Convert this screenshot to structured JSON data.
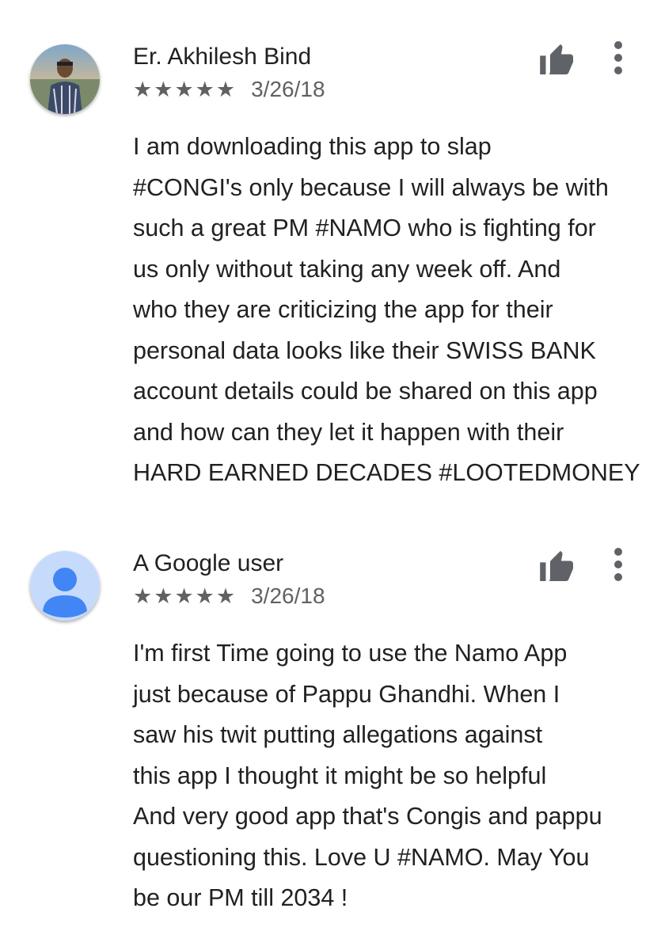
{
  "reviews": [
    {
      "author": "Er. Akhilesh Bind",
      "avatar": "user-photo",
      "stars": [
        "★",
        "★",
        "★",
        "★",
        "★"
      ],
      "rating": 5,
      "date": "3/26/18",
      "helpful_icon": "thumbs-up-icon",
      "menu_icon": "more-vert-icon",
      "lines": [
        "I am downloading this app to slap",
        "#CONGI's only because I will always be with",
        "such a great PM #NAMO who is fighting for",
        "us only without taking any week off. And",
        "who they are criticizing the app for their",
        "personal data looks like their SWISS BANK",
        "account details could be shared on this app",
        "and how can they let it happen with their",
        "HARD EARNED DECADES #LOOTEDMONEY"
      ]
    },
    {
      "author": "A Google user",
      "avatar": "default-user-avatar-icon",
      "stars": [
        "★",
        "★",
        "★",
        "★",
        "★"
      ],
      "rating": 5,
      "date": "3/26/18",
      "helpful_icon": "thumbs-up-icon",
      "menu_icon": "more-vert-icon",
      "lines": [
        "I'm first Time going to use the Namo App",
        "just because of Pappu Ghandhi. When I",
        "saw his twit putting allegations against",
        "this app I thought it might be so helpful",
        "And very good app that's Congis and pappu",
        "questioning this. Love U #NAMO. May You",
        "be our PM till 2034 !"
      ]
    }
  ],
  "colors": {
    "text_primary": "#212121",
    "text_secondary": "#616161",
    "icon": "#5f6368",
    "default_avatar_bg": "#c6dafc",
    "default_avatar_fg": "#4285f4"
  }
}
